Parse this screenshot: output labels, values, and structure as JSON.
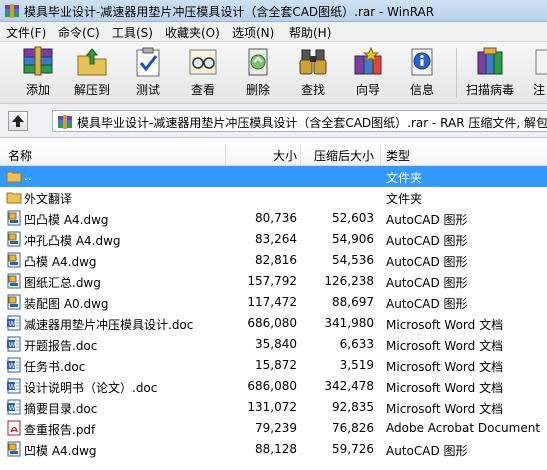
{
  "window": {
    "title": "模具毕业设计-减速器用垫片冲压模具设计（含全套CAD图纸）.rar - WinRAR"
  },
  "menu": [
    {
      "label": "文件(F)"
    },
    {
      "label": "命令(C)"
    },
    {
      "label": "工具(S)"
    },
    {
      "label": "收藏夹(O)"
    },
    {
      "label": "选项(N)"
    },
    {
      "label": "帮助(H)"
    }
  ],
  "toolbar": [
    {
      "label": "添加",
      "icon": "add-books-icon"
    },
    {
      "label": "解压到",
      "icon": "extract-folder-icon"
    },
    {
      "label": "测试",
      "icon": "test-clipboard-icon"
    },
    {
      "label": "查看",
      "icon": "view-glasses-icon"
    },
    {
      "label": "删除",
      "icon": "delete-recycle-icon"
    },
    {
      "label": "查找",
      "icon": "find-binoculars-icon"
    },
    {
      "label": "向导",
      "icon": "wizard-icon"
    },
    {
      "label": "信息",
      "icon": "info-icon"
    },
    {
      "label": "扫描病毒",
      "icon": "scan-virus-icon"
    },
    {
      "label": "注",
      "icon": "comment-icon"
    }
  ],
  "path": {
    "text": "模具毕业设计-减速器用垫片冲压模具设计（含全套CAD图纸）.rar - RAR 压缩文件, 解包"
  },
  "columns": {
    "name": "名称",
    "size": "大小",
    "packed": "压缩后大小",
    "type": "类型"
  },
  "files": [
    {
      "name": "..",
      "size": "",
      "packed": "",
      "type": "文件夹",
      "kind": "folder"
    },
    {
      "name": "外文翻译",
      "size": "",
      "packed": "",
      "type": "文件夹",
      "kind": "folder"
    },
    {
      "name": "凹凸模 A4.dwg",
      "size": "80,736",
      "packed": "52,603",
      "type": "AutoCAD 图形",
      "kind": "dwg"
    },
    {
      "name": "冲孔凸模 A4.dwg",
      "size": "83,264",
      "packed": "54,906",
      "type": "AutoCAD 图形",
      "kind": "dwg"
    },
    {
      "name": "凸模 A4.dwg",
      "size": "82,816",
      "packed": "54,536",
      "type": "AutoCAD 图形",
      "kind": "dwg"
    },
    {
      "name": "图纸汇总.dwg",
      "size": "157,792",
      "packed": "126,238",
      "type": "AutoCAD 图形",
      "kind": "dwg"
    },
    {
      "name": "装配图 A0.dwg",
      "size": "117,472",
      "packed": "88,697",
      "type": "AutoCAD 图形",
      "kind": "dwg"
    },
    {
      "name": "减速器用垫片冲压模具设计.doc",
      "size": "686,080",
      "packed": "341,980",
      "type": "Microsoft Word 文档",
      "kind": "doc"
    },
    {
      "name": "开题报告.doc",
      "size": "35,840",
      "packed": "6,633",
      "type": "Microsoft Word 文档",
      "kind": "doc"
    },
    {
      "name": "任务书.doc",
      "size": "15,872",
      "packed": "3,519",
      "type": "Microsoft Word 文档",
      "kind": "doc"
    },
    {
      "name": "设计说明书（论文）.doc",
      "size": "686,080",
      "packed": "342,478",
      "type": "Microsoft Word 文档",
      "kind": "doc"
    },
    {
      "name": "摘要目录.doc",
      "size": "131,072",
      "packed": "92,835",
      "type": "Microsoft Word 文档",
      "kind": "doc"
    },
    {
      "name": "查重报告.pdf",
      "size": "79,239",
      "packed": "76,826",
      "type": "Adobe Acrobat Document",
      "kind": "pdf"
    },
    {
      "name": "凹模 A4.dwg",
      "size": "88,128",
      "packed": "59,726",
      "type": "AutoCAD 图形",
      "kind": "dwg"
    }
  ],
  "selected_row": 0
}
